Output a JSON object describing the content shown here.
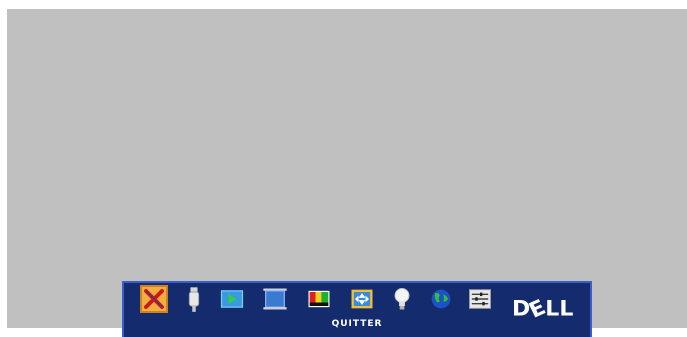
{
  "osd": {
    "selected_label": "QUITTER",
    "logo_text": "D",
    "logo_e": "E",
    "logo_rest": "LL",
    "menu_icons": [
      {
        "name": "exit-icon",
        "selected": true
      },
      {
        "name": "input-source-icon",
        "selected": false
      },
      {
        "name": "auto-adjust-icon",
        "selected": false
      },
      {
        "name": "picture-icon",
        "selected": false
      },
      {
        "name": "display-color-icon",
        "selected": false
      },
      {
        "name": "projection-mode-icon",
        "selected": false
      },
      {
        "name": "lamp-icon",
        "selected": false
      },
      {
        "name": "language-icon",
        "selected": false
      },
      {
        "name": "preferences-icon",
        "selected": false
      }
    ]
  },
  "colors": {
    "background": "#c0c0c0",
    "osd_bar": "#142c6e",
    "osd_border": "#3b5fc8",
    "selection": "#f0b040"
  }
}
